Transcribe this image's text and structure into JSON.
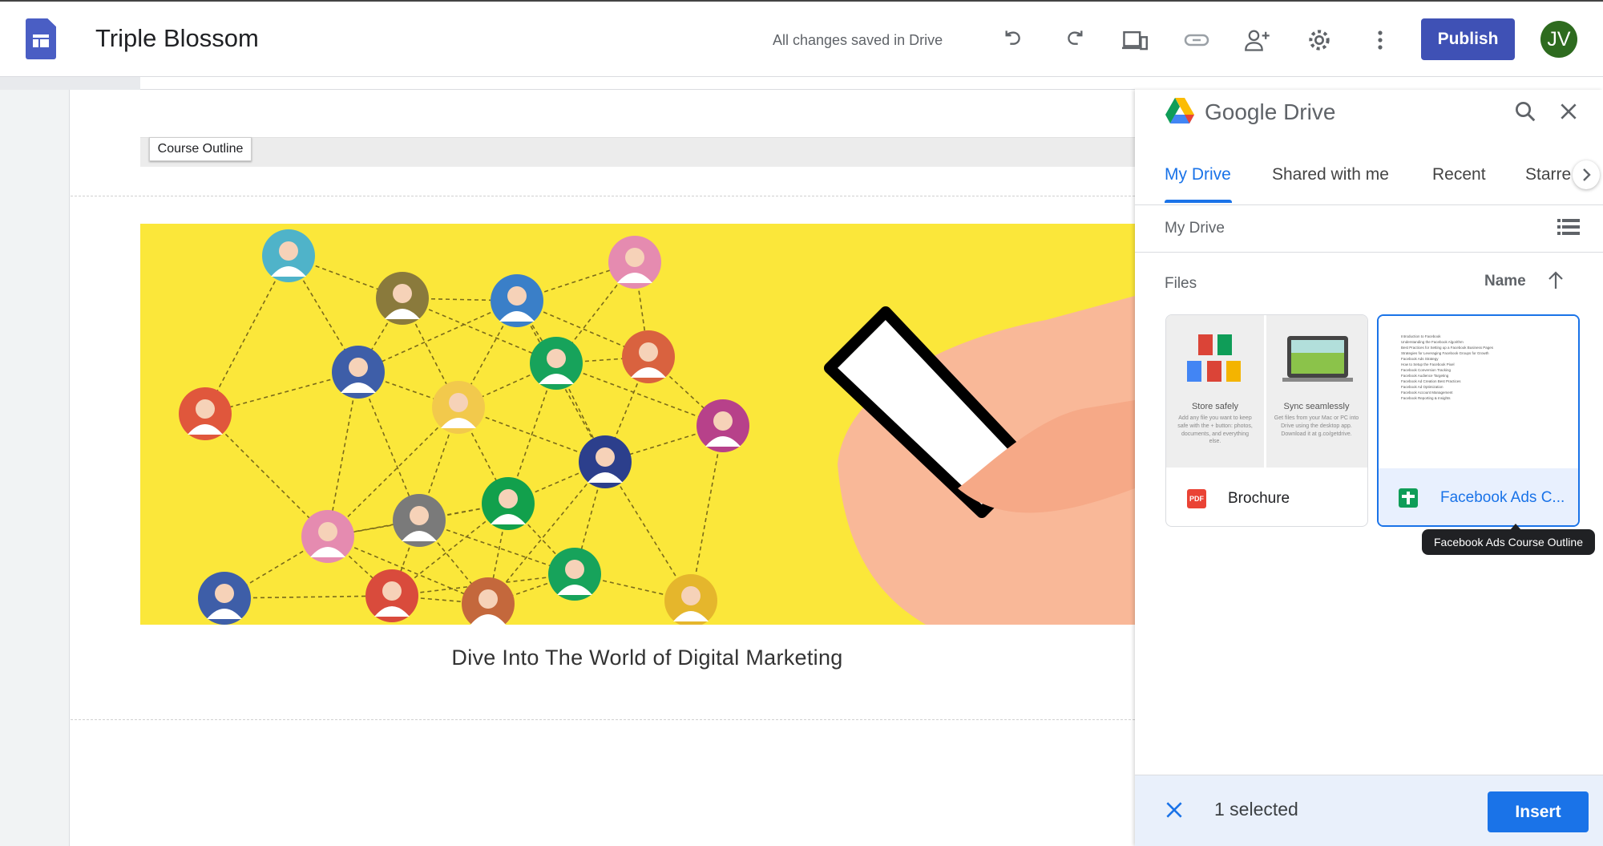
{
  "header": {
    "title": "Triple Blossom",
    "save_status": "All changes saved in Drive",
    "publish_label": "Publish",
    "avatar_initials": "JV",
    "avatar_color": "#2e6b1f",
    "accent": "#3f51b5",
    "icons": [
      "undo-icon",
      "redo-icon",
      "preview-icon",
      "link-icon",
      "share-icon",
      "settings-icon",
      "more-icon"
    ]
  },
  "page": {
    "header_button": "Course Outline",
    "image_caption": "Dive Into The World of Digital Marketing"
  },
  "drive": {
    "title": "Google Drive",
    "tabs": [
      {
        "label": "My Drive",
        "active": true
      },
      {
        "label": "Shared with me"
      },
      {
        "label": "Recent"
      },
      {
        "label": "Starre"
      }
    ],
    "breadcrumb": "My Drive",
    "section": "Files",
    "sort_label": "Name",
    "files": [
      {
        "name": "Brochure",
        "type": "pdf",
        "thumb": {
          "left_title": "Store safely",
          "left_text": "Add any file you want to keep safe with the + button: photos, documents, and everything else.",
          "right_title": "Sync seamlessly",
          "right_text": "Get files from your Mac or PC into Drive using the desktop app. Download it at g.co/getdrive."
        }
      },
      {
        "name": "Facebook Ads C...",
        "type": "sheets",
        "selected": true,
        "tooltip": "Facebook Ads Course Outline",
        "thumb_lines": [
          "Introduction to Facebook",
          "Understanding the Facebook Algorithm",
          "Best Practices for Setting up a Facebook Business Pages",
          "Strategies for Leveraging Facebook Groups for Growth",
          "Facebook Ads Strategy",
          "How to Setup the Facebook Pixel",
          "Facebook Conversion Tracking",
          "Facebook Audience Targeting",
          "Facebook Ad Creation Best Practices",
          "Facebook Ad Optimization",
          "Facebook Account Management",
          "Facebook Reporting & Insights"
        ]
      }
    ],
    "selected_count": "1 selected",
    "insert_label": "Insert",
    "selected_color": "#1a73e8"
  }
}
